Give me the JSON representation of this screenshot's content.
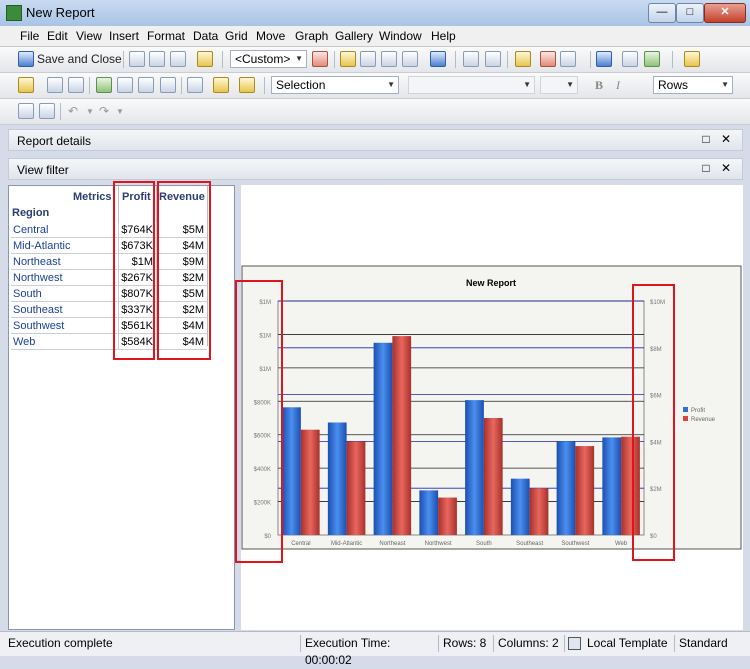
{
  "window": {
    "title": "New Report",
    "min_glyph": "—",
    "max_glyph": "□",
    "close_glyph": "✕"
  },
  "menu": [
    "File",
    "Edit",
    "View",
    "Insert",
    "Format",
    "Data",
    "Grid",
    "Move",
    "Graph",
    "Gallery",
    "Window",
    "Help"
  ],
  "toolbar": {
    "save_close": "Save and Close",
    "template_combo": "<Custom>",
    "selection_combo": "Selection",
    "rows_combo": "Rows",
    "bold": "B",
    "italic": "I"
  },
  "panels": {
    "report_details": "Report details",
    "view_filter": "View filter",
    "restore_glyph": "□",
    "close_glyph": "✕"
  },
  "grid": {
    "metrics_label": "Metrics",
    "region_label": "Region",
    "columns": [
      "Profit",
      "Revenue"
    ],
    "rows": [
      {
        "region": "Central",
        "profit": "$764K",
        "revenue": "$5M"
      },
      {
        "region": "Mid-Atlantic",
        "profit": "$673K",
        "revenue": "$4M"
      },
      {
        "region": "Northeast",
        "profit": "$1M",
        "revenue": "$9M"
      },
      {
        "region": "Northwest",
        "profit": "$267K",
        "revenue": "$2M"
      },
      {
        "region": "South",
        "profit": "$807K",
        "revenue": "$5M"
      },
      {
        "region": "Southeast",
        "profit": "$337K",
        "revenue": "$2M"
      },
      {
        "region": "Southwest",
        "profit": "$561K",
        "revenue": "$4M"
      },
      {
        "region": "Web",
        "profit": "$584K",
        "revenue": "$4M"
      }
    ]
  },
  "chart_data": {
    "type": "bar",
    "title": "New Report",
    "categories": [
      "Central",
      "Mid-Atlantic",
      "Northeast",
      "Northwest",
      "South",
      "Southeast",
      "Southwest",
      "Web"
    ],
    "series": [
      {
        "name": "Profit",
        "axis": "left",
        "values": [
          764,
          673,
          1150,
          267,
          807,
          337,
          561,
          584
        ],
        "color": "#2e6fd8"
      },
      {
        "name": "Revenue",
        "axis": "right",
        "values": [
          4.5,
          4.0,
          8.5,
          1.6,
          5.0,
          2.0,
          3.8,
          4.2
        ],
        "color": "#d9453d"
      }
    ],
    "left_axis": {
      "ticks": [
        "$0",
        "$200K",
        "$400K",
        "$600K",
        "$800K",
        "$1M",
        "$1M",
        "$1M"
      ],
      "ylim": [
        0,
        1400
      ]
    },
    "right_axis": {
      "ticks": [
        "$0",
        "$2M",
        "$4M",
        "$6M",
        "$8M",
        "$10M"
      ],
      "ylim": [
        0,
        10
      ]
    },
    "legend_position": "right",
    "grid": true
  },
  "status": {
    "message": "Execution complete",
    "exec_time": "Execution Time: 00:00:02",
    "rows": "Rows: 8",
    "columns": "Columns: 2",
    "template": "Local Template",
    "mode": "Standard"
  }
}
